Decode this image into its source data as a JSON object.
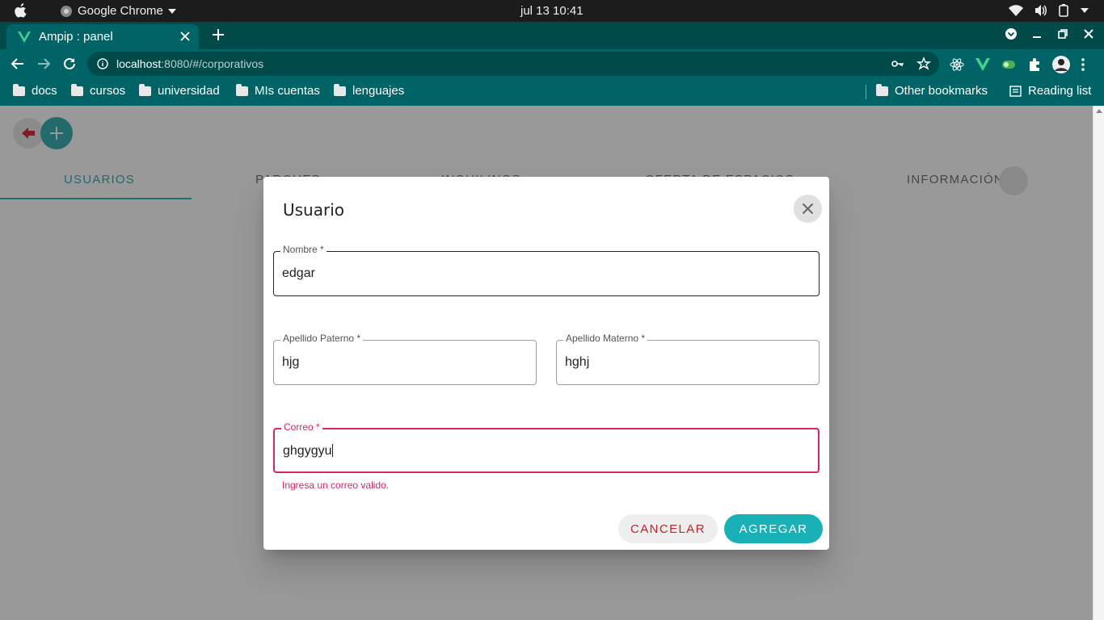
{
  "os": {
    "app_name": "Google Chrome",
    "clock": "jul 13  10:41"
  },
  "browser": {
    "tab_title": "Ampip : panel",
    "url_host": "localhost",
    "url_path": ":8080/#/corporativos",
    "bookmarks": [
      "docs",
      "cursos",
      "universidad",
      "MIs cuentas",
      "lenguajes"
    ],
    "other_bookmarks": "Other bookmarks",
    "reading_list": "Reading list"
  },
  "page": {
    "tabs": [
      "USUARIOS",
      "PARQUES",
      "INQUILINOS",
      "OFERTA DE ESPACIOS",
      "INFORMACIÓN"
    ],
    "active_tab": "USUARIOS"
  },
  "dialog": {
    "title": "Usuario",
    "fields": {
      "nombre": {
        "label": "Nombre *",
        "value": "edgar"
      },
      "apellido_paterno": {
        "label": "Apellido Paterno *",
        "value": "hjg"
      },
      "apellido_materno": {
        "label": "Apellido Materno *",
        "value": "hghj"
      },
      "correo": {
        "label": "Correo *",
        "value": "ghgygyu",
        "error": "Ingresa un correo valido."
      }
    },
    "cancel_label": "CANCELAR",
    "add_label": "AGREGAR"
  },
  "colors": {
    "chrome_dark": "#004a4a",
    "chrome_toolbar": "#006466",
    "accent": "#26a8ad",
    "error": "#e0245e",
    "cancel_text": "#c0262a"
  }
}
